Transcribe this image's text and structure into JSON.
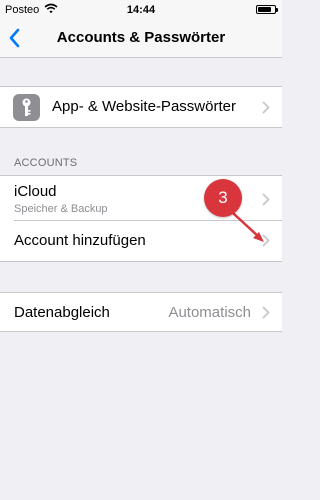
{
  "status_bar": {
    "carrier": "Posteo",
    "time": "14:44",
    "battery_level": 0.8
  },
  "nav": {
    "title": "Accounts & Passwörter",
    "back_icon": "chevron-left-icon"
  },
  "passwords_row": {
    "label": "App- & Website-Passwörter",
    "icon": "key-icon"
  },
  "accounts_section": {
    "header": "ACCOUNTS",
    "icloud": {
      "label": "iCloud",
      "subtitle": "Speicher & Backup"
    },
    "add_account": {
      "label": "Account hinzufügen"
    }
  },
  "fetch_row": {
    "label": "Datenabgleich",
    "value": "Automatisch"
  },
  "annotation": {
    "step_number": "3",
    "color": "#d9353d"
  },
  "colors": {
    "accent": "#007aff",
    "background": "#efeff4",
    "separator": "#c8c7cc"
  }
}
